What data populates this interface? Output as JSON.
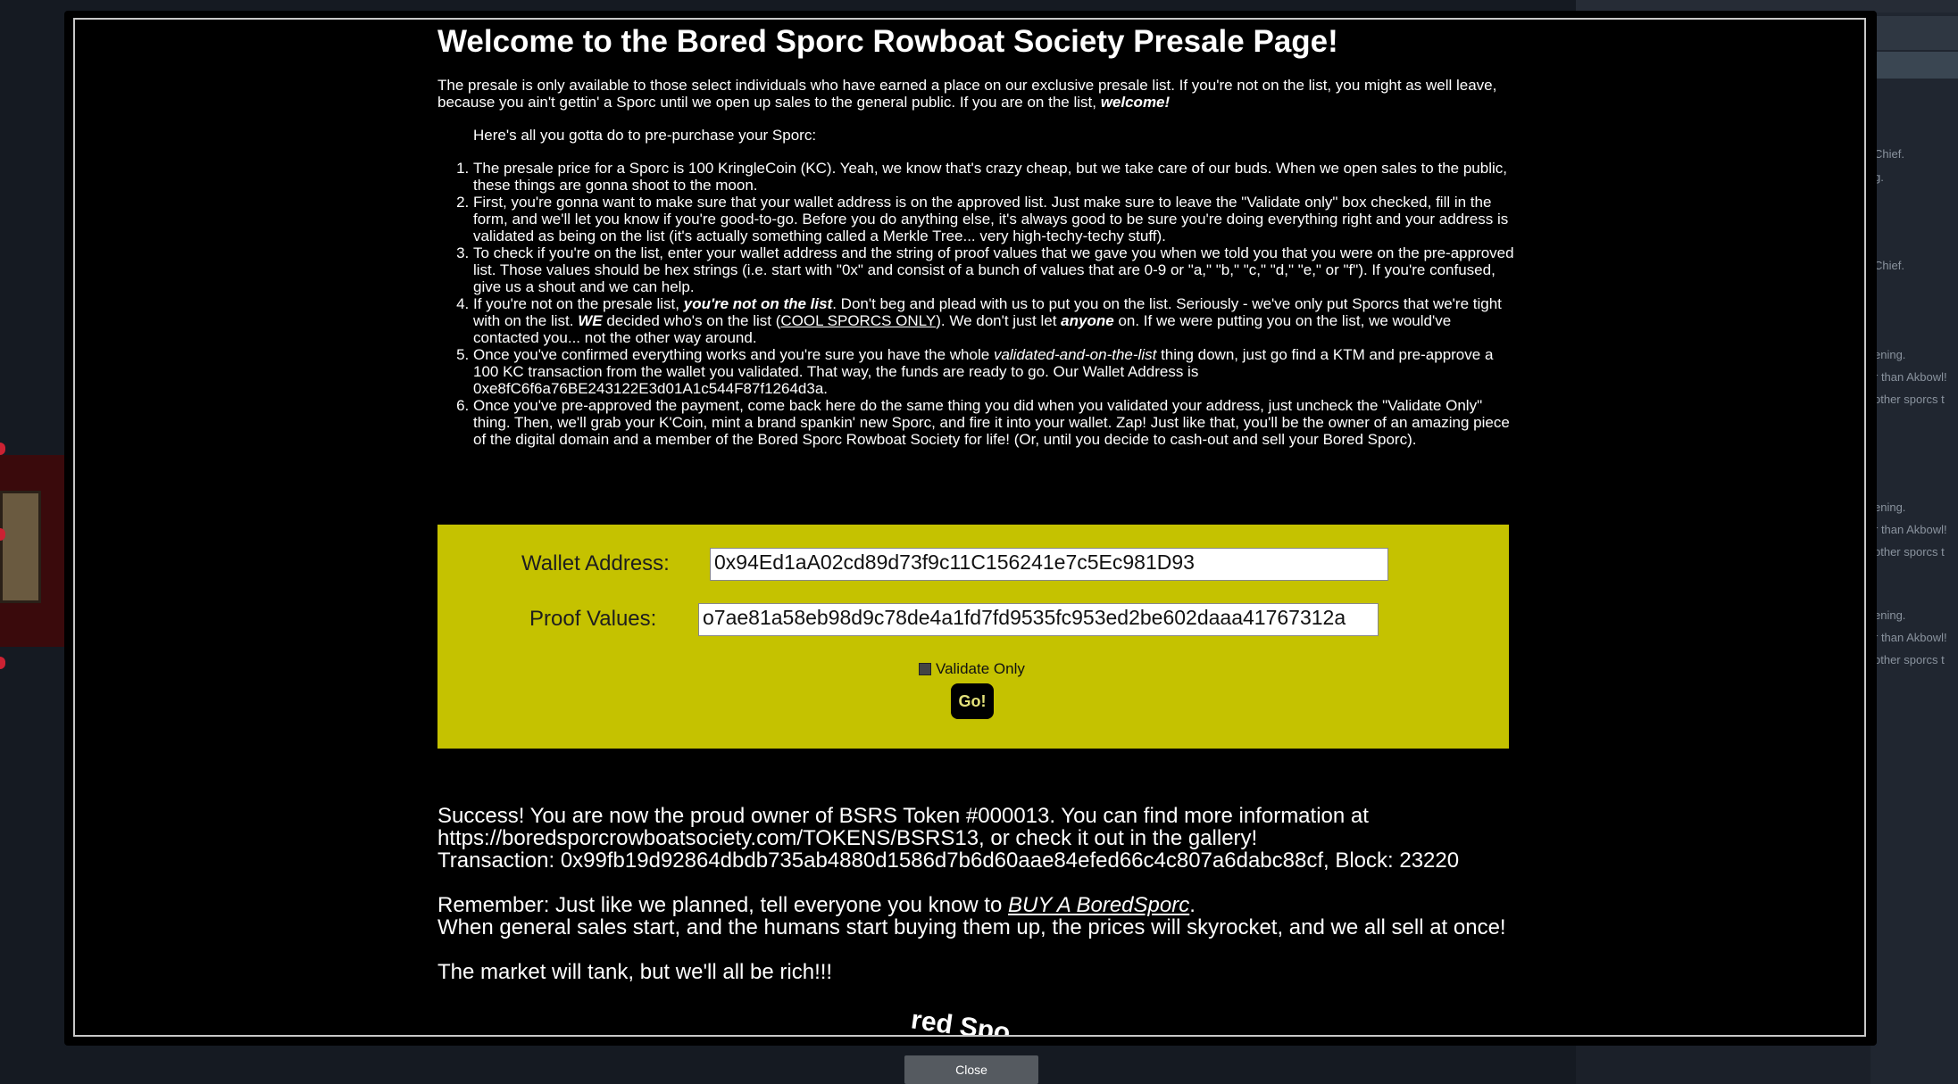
{
  "background": {
    "chat_lines": [
      "Chief.",
      "g.",
      "Chief.",
      "ening.",
      "r than Akbowl!",
      "other sporcs t",
      "ening.",
      "r than Akbowl!",
      "other sporcs t",
      "ening.",
      "r than Akbowl!",
      "other sporcs t"
    ]
  },
  "page": {
    "title": "Welcome to the Bored Sporc Rowboat Society Presale Page!",
    "intro": "The presale is only available to those select individuals who have earned a place on our exclusive presale list. If you're not on the list, you might as well leave, because you ain't gettin' a Sporc until we open up sales to the general public. If you are on the list,",
    "intro_emph": "welcome!",
    "lead": "Here's all you gotta do to pre-purchase your Sporc:",
    "step1": "The presale price for a Sporc is 100 KringleCoin (KC). Yeah, we know that's crazy cheap, but we take care of our buds. When we open sales to the public, these things are gonna shoot to the moon.",
    "step2": "First, you're gonna want to make sure that your wallet address is on the approved list. Just make sure to leave the \"Validate only\" box checked, fill in the form, and we'll let you know if you're good-to-go. Before you do anything else, it's always good to be sure you're doing everything right and your address is validated as being on the list (it's actually something called a Merkle Tree... very high-techy-techy stuff).",
    "step3": "To check if you're on the list, enter your wallet address and the string of proof values that we gave you when we told you that you were on the pre-approved list. Those values should be hex strings (i.e. start with \"0x\" and consist of a bunch of values that are 0-9 or \"a,\" \"b,\" \"c,\" \"d,\" \"e,\" or \"f\"). If you're confused, give us a shout and we can help.",
    "step4_a": "If you're not on the presale list,",
    "step4_b": "you're not on the list",
    "step4_c": ". Don't beg and plead with us to put you on the list. Seriously - we've only put Sporcs that we're tight with on the list.",
    "step4_d": "WE",
    "step4_e": "decided who's on the list (",
    "step4_link": "COOL SPORCS ONLY",
    "step4_f": "). We don't just let",
    "step4_g": "anyone",
    "step4_h": "on. If we were putting you on the list, we would've contacted you... not the other way around.",
    "step5_a": "Once you've confirmed everything works and you're sure you have the whole",
    "step5_b": "validated-and-on-the-list",
    "step5_c": "thing down, just go find a KTM and pre-approve a 100 KC transaction from the wallet you validated. That way, the funds are ready to go. Our Wallet Address is 0xe8fC6f6a76BE243122E3d01A1c544F87f1264d3a.",
    "step6": "Once you've pre-approved the payment, come back here do the same thing you did when you validated your address, just uncheck the \"Validate Only\" thing. Then, we'll grab your K'Coin, mint a brand spankin' new Sporc, and fire it into your wallet. Zap! Just like that, you'll be the owner of an amazing piece of the digital domain and a member of the Bored Sporc Rowboat Society for life! (Or, until you decide to cash-out and sell your Bored Sporc)."
  },
  "form": {
    "wallet_label": "Wallet Address:",
    "wallet_value": "0x94Ed1aA02cd89d73f9c11C156241e7c5Ec981D93",
    "proof_label": "Proof Values:",
    "proof_value": "o7ae81a58eb98d9c78de4a1fd7fd9535fc953ed2be602daaa41767312a",
    "validate_label": "Validate Only",
    "validate_checked": false,
    "go_label": "Go!"
  },
  "result": {
    "line1": "Success! You are now the proud owner of BSRS Token #000013. You can find more information at",
    "line2": "https://boredsporcrowboatsociety.com/TOKENS/BSRS13, or check it out in the gallery!",
    "line3": "Transaction: 0x99fb19d92864dbdb735ab4880d1586d7b6d60aae84efed66c4c807a6dabc88cf, Block: 23220",
    "remember_a": "Remember: Just like we planned, tell everyone you know to",
    "remember_link": "BUY A BoredSporc",
    "remember_b": ".",
    "line5": "When general sales start, and the humans start buying them up, the prices will skyrocket, and we all sell at once!",
    "line6": "The market will tank, but we'll all be rich!!!",
    "logo_peek": "red Spo"
  },
  "close_label": "Close"
}
